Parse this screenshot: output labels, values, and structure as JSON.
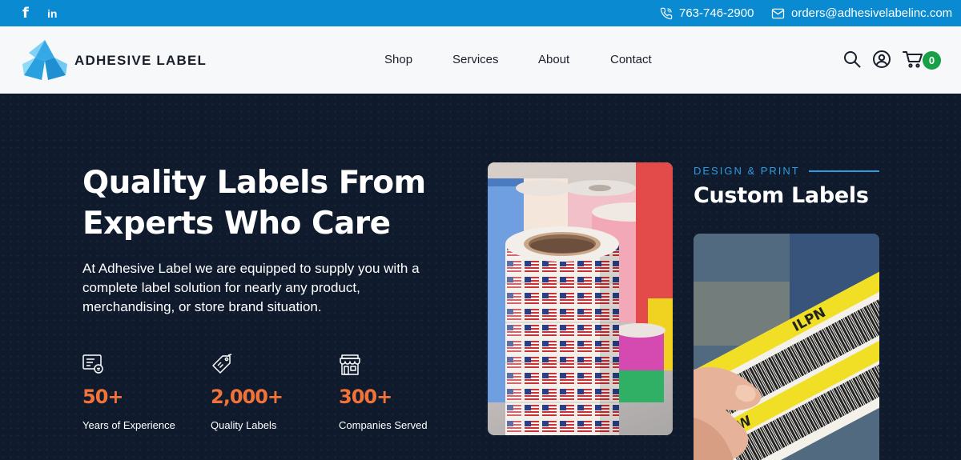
{
  "topbar": {
    "social": {
      "facebook": "f",
      "linkedin": "in"
    },
    "phone": "763-746-2900",
    "email": "orders@adhesivelabelinc.com"
  },
  "header": {
    "brand": "ADHESIVE LABEL",
    "nav": [
      "Shop",
      "Services",
      "About",
      "Contact"
    ],
    "cart_count": "0",
    "icons": [
      "search-icon",
      "user-icon",
      "cart-icon"
    ]
  },
  "hero": {
    "headline_line1": "Quality Labels From",
    "headline_line2": "Experts Who Care",
    "description": "At Adhesive Label we are equipped to supply you with a complete label solution for nearly any product, merchandising, or store brand situation.",
    "stats": [
      {
        "icon": "certificate-icon",
        "value": "50+",
        "label": "Years of Experience"
      },
      {
        "icon": "tag-icon",
        "value": "2,000+",
        "label": "Quality Labels"
      },
      {
        "icon": "storefront-icon",
        "value": "300+",
        "label": "Companies Served"
      }
    ]
  },
  "feature": {
    "kicker": "DESIGN & PRINT",
    "title": "Custom Labels"
  },
  "colors": {
    "topbar": "#0a8ad0",
    "hero_bg": "#0f1b2d",
    "accent_orange": "#f2733a",
    "accent_blue": "#2f9be0",
    "cart_badge": "#17a046"
  }
}
